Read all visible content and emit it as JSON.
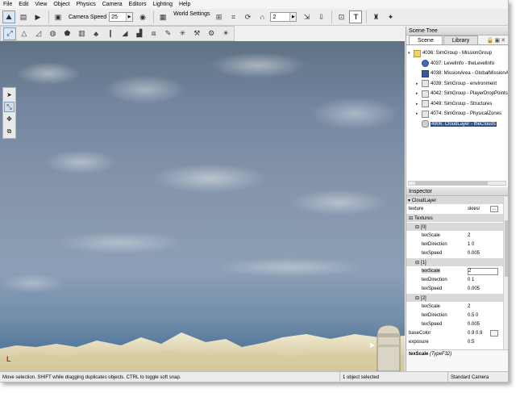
{
  "menus": [
    "File",
    "Edit",
    "View",
    "Object",
    "Physics",
    "Camera",
    "Editors",
    "Lighting",
    "Help"
  ],
  "toolbar": {
    "camera_speed_label": "Camera Speed",
    "camera_speed_value": "25",
    "world_settings_label": "World Settings",
    "snap_value": "2",
    "text_tool_glyph": "T"
  },
  "viewport": {
    "axis_label": "L",
    "tool_icons": [
      "arrow-select-icon",
      "camera-move-icon",
      "rotate-icon",
      "scale-icon"
    ],
    "sky_colors": {
      "top": "#5f7183",
      "horizon": "#3f6690",
      "terrain": "#e3dcb9"
    }
  },
  "scene_tree": {
    "title": "Scene Tree",
    "tabs": [
      "Scene",
      "Library"
    ],
    "items": [
      {
        "label": "4036: SimGroup - MissionGroup",
        "icon": "folder-open",
        "expander": "▾",
        "indent": 0
      },
      {
        "label": "4037: LevelInfo - theLevelInfo",
        "icon": "info",
        "expander": "",
        "indent": 1
      },
      {
        "label": "4038: MissionArea - GlobalMissionArea",
        "icon": "mission",
        "expander": "",
        "indent": 1
      },
      {
        "label": "4039: SimGroup - environment",
        "icon": "folder",
        "expander": "▸",
        "indent": 1
      },
      {
        "label": "4042: SimGroup - PlayerDropPoints",
        "icon": "folder",
        "expander": "▸",
        "indent": 1
      },
      {
        "label": "4049: SimGroup - Structures",
        "icon": "folder",
        "expander": "▸",
        "indent": 1
      },
      {
        "label": "4074: SimGroup - PhysicalZones",
        "icon": "folder",
        "expander": "▸",
        "indent": 1
      },
      {
        "label": "4906: CloudLayer - theClouds",
        "icon": "cloud",
        "expander": "",
        "indent": 1,
        "selected": true
      }
    ]
  },
  "inspector": {
    "title": "Inspector",
    "object_header": "CloudLayer",
    "rows": [
      {
        "type": "field",
        "key": "texture",
        "value": "skies/",
        "indent": 0,
        "browse": "..."
      },
      {
        "type": "group",
        "key": "Textures",
        "indent": 0,
        "toggle": "⊟"
      },
      {
        "type": "group",
        "key": "[0]",
        "indent": 1,
        "toggle": "⊟"
      },
      {
        "type": "field",
        "key": "texScale",
        "value": "2",
        "indent": 2
      },
      {
        "type": "field",
        "key": "texDirection",
        "value": "1 0",
        "indent": 2
      },
      {
        "type": "field",
        "key": "texSpeed",
        "value": "0.005",
        "indent": 2
      },
      {
        "type": "group",
        "key": "[1]",
        "indent": 1,
        "toggle": "⊟"
      },
      {
        "type": "field",
        "key": "texScale",
        "value": "2",
        "indent": 2,
        "editing": true
      },
      {
        "type": "field",
        "key": "texDirection",
        "value": "0 1",
        "indent": 2
      },
      {
        "type": "field",
        "key": "texSpeed",
        "value": "0.005",
        "indent": 2
      },
      {
        "type": "group",
        "key": "[2]",
        "indent": 1,
        "toggle": "⊟"
      },
      {
        "type": "field",
        "key": "texScale",
        "value": "2",
        "indent": 2
      },
      {
        "type": "field",
        "key": "texDirection",
        "value": "0.5 0",
        "indent": 2
      },
      {
        "type": "field",
        "key": "texSpeed",
        "value": "0.005",
        "indent": 2
      },
      {
        "type": "field",
        "key": "baseColor",
        "value": "0.9 0.9",
        "indent": 0,
        "browse": ""
      },
      {
        "type": "field",
        "key": "exposure",
        "value": "0.5",
        "indent": 0
      }
    ],
    "help_field": "texScale",
    "help_type": "(TypeF32)"
  },
  "statusbar": {
    "hint": "Move selection.  SHIFT while dragging duplicates objects.  CTRL to toggle soft snap.",
    "selection": "1 object selected",
    "camera": "Standard Camera"
  }
}
